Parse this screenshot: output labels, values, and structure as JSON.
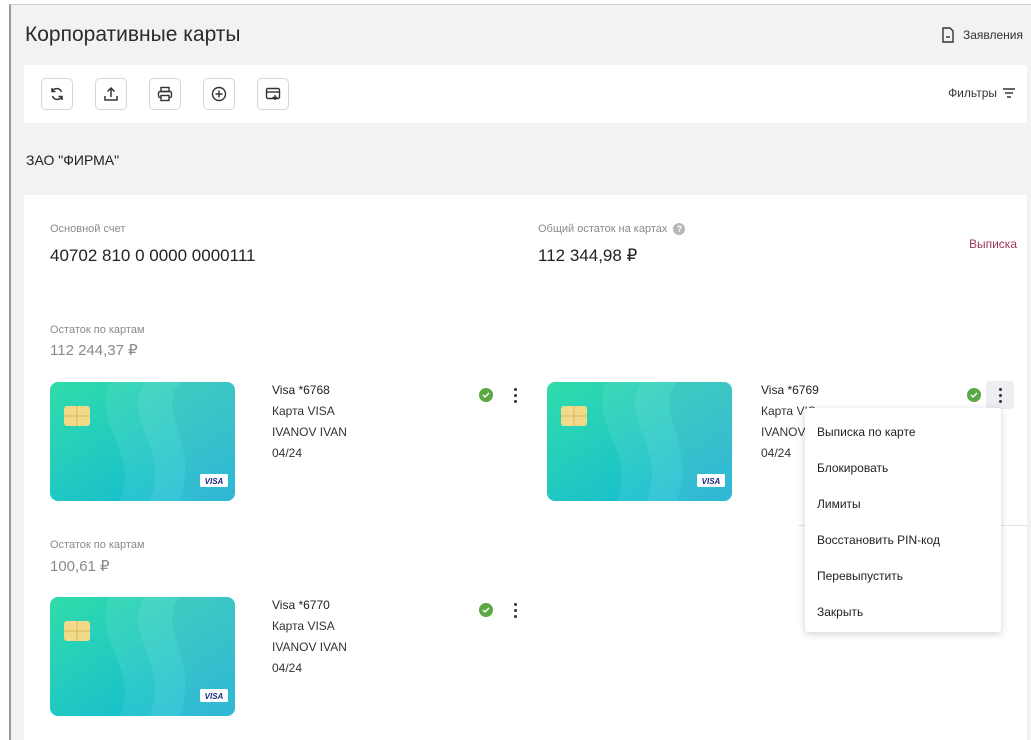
{
  "header": {
    "title": "Корпоративные карты",
    "applications_label": "Заявления"
  },
  "toolbar": {
    "buttons": [
      {
        "name": "refresh-icon"
      },
      {
        "name": "upload-icon"
      },
      {
        "name": "print-icon"
      },
      {
        "name": "add-circle-icon"
      },
      {
        "name": "card-add-icon"
      }
    ],
    "filters_label": "Фильтры"
  },
  "company": "ЗАО \"ФИРМА\"",
  "account": {
    "main_label": "Основной счет",
    "main_value": "40702 810 0 0000 0000111",
    "total_label": "Общий остаток на картах",
    "total_value": "112 344,98 ₽",
    "statement_link": "Выписка"
  },
  "groups": [
    {
      "balance_label": "Остаток по картам",
      "balance_value": "112 244,37 ₽",
      "cards": [
        {
          "number": "Visa *6768",
          "type": "Карта VISA",
          "holder": "IVANOV IVAN",
          "expiry": "04/24",
          "status": "active"
        },
        {
          "number": "Visa *6769",
          "type": "Карта VIS",
          "holder": "IVANOV I\\",
          "expiry": "04/24",
          "status": "active"
        }
      ]
    },
    {
      "balance_label": "Остаток по картам",
      "balance_value": "100,61 ₽",
      "cards": [
        {
          "number": "Visa *6770",
          "type": "Карта VISA",
          "holder": "IVANOV IVAN",
          "expiry": "04/24",
          "status": "active"
        }
      ]
    }
  ],
  "card_brand": "VISA",
  "context_menu": {
    "items": [
      "Выписка по карте",
      "Блокировать",
      "Лимиты",
      "Восстановить PIN-код",
      "Перевыпустить",
      "Закрыть"
    ]
  },
  "colors": {
    "accent_link": "#a0385a",
    "status_ok": "#5aa843",
    "card_gradient_start": "#2fd7a9",
    "card_gradient_end": "#12b8d8"
  }
}
